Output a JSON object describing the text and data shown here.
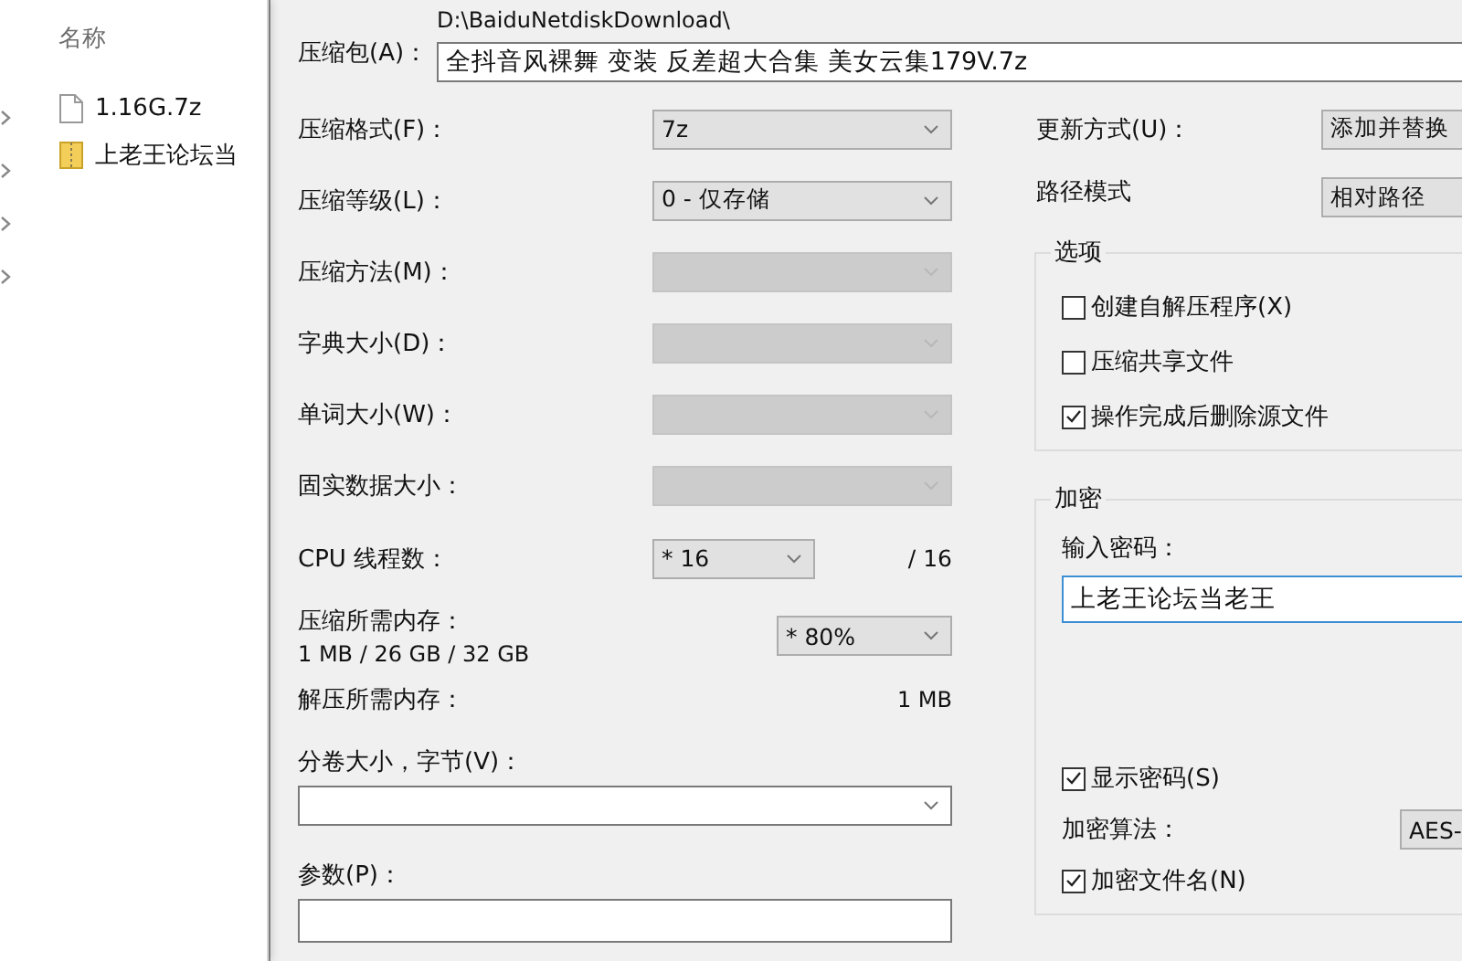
{
  "explorer": {
    "column_header": "名称",
    "files": [
      {
        "name": "1.16G.7z",
        "kind": "file"
      },
      {
        "name": "上老王论坛当",
        "kind": "archive"
      }
    ]
  },
  "dialog": {
    "archive": {
      "label": "压缩包(A)：",
      "folder": "D:\\BaiduNetdiskDownload\\",
      "value": "全抖音风裸舞 变装 反差超大合集 美女云集179V.7z"
    },
    "settings": [
      {
        "label": "压缩格式(F)：",
        "value": "7z",
        "disabled": false
      },
      {
        "label": "压缩等级(L)：",
        "value": "0 - 仅存储",
        "disabled": false
      },
      {
        "label": "压缩方法(M)：",
        "disabled": true
      },
      {
        "label": "字典大小(D)：",
        "disabled": true
      },
      {
        "label": "单词大小(W)：",
        "disabled": true
      },
      {
        "label": "固实数据大小：",
        "disabled": true
      }
    ],
    "cpu": {
      "label": "CPU 线程数：",
      "value": "* 16",
      "max": "/ 16"
    },
    "memory": {
      "label": "压缩所需内存：",
      "detail": "1 MB / 26 GB / 32 GB",
      "value": "* 80%"
    },
    "decompress": {
      "label": "解压所需内存：",
      "value": "1 MB"
    },
    "volume": {
      "label": "分卷大小，字节(V)："
    },
    "parameters": {
      "label": "参数(P)："
    },
    "update": {
      "label": "更新方式(U)：",
      "value": "添加并替换"
    },
    "path_mode": {
      "label": "路径模式",
      "value": "相对路径"
    },
    "options": {
      "title": "选项",
      "items": [
        {
          "label": "创建自解压程序(X)",
          "checked": false
        },
        {
          "label": "压缩共享文件",
          "checked": false
        },
        {
          "label": "操作完成后删除源文件",
          "checked": true
        }
      ]
    },
    "encryption": {
      "title": "加密",
      "password_label": "输入密码：",
      "password": "上老王论坛当老王",
      "show_password": {
        "label": "显示密码(S)",
        "checked": true
      },
      "method_label": "加密算法：",
      "method": "AES-",
      "encrypt_names": {
        "label": "加密文件名(N)",
        "checked": true
      }
    }
  }
}
